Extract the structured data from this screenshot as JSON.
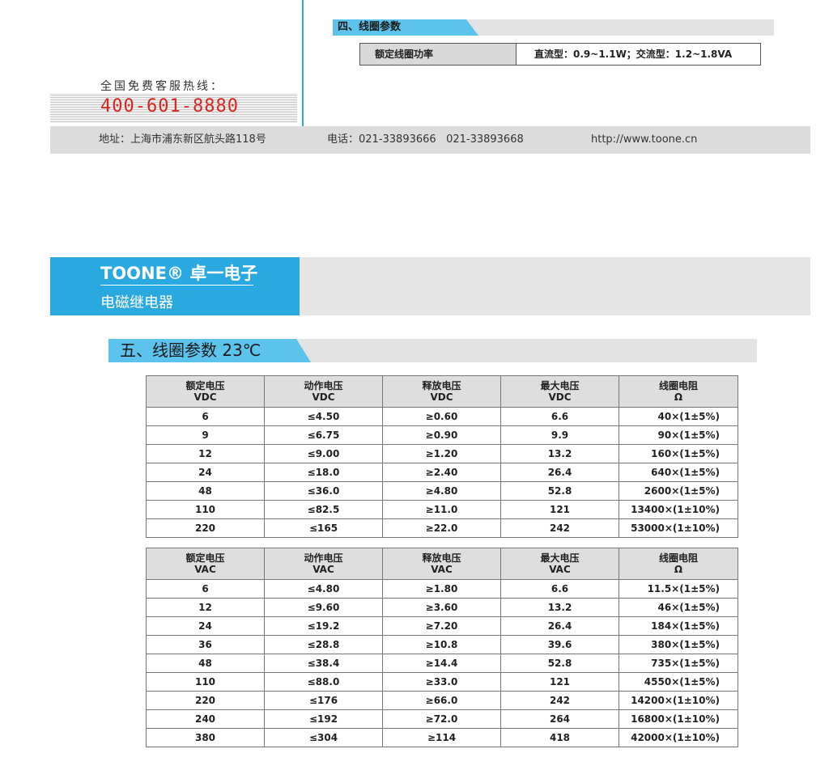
{
  "section4": {
    "title": "四、线圈参数",
    "coil_power_label": "额定线圈功率",
    "coil_power_value": "直流型：0.9~1.1W；交流型：1.2~1.8VA"
  },
  "hotline": {
    "label": "全国免费客服热线：",
    "number": "400-601-8880"
  },
  "contact": {
    "address": "地址：上海市浦东新区航头路118号",
    "phone": "电话：021-33893666   021-33893668",
    "website": "http://www.toone.cn"
  },
  "brand": {
    "name": "TOONE® 卓一电子",
    "subtitle": "电磁继电器"
  },
  "section5": {
    "title": "五、线圈参数 23℃"
  },
  "dc_table": {
    "headers": [
      {
        "line1": "额定电压",
        "line2": "VDC"
      },
      {
        "line1": "动作电压",
        "line2": "VDC"
      },
      {
        "line1": "释放电压",
        "line2": "VDC"
      },
      {
        "line1": "最大电压",
        "line2": "VDC"
      },
      {
        "line1": "线圈电阻",
        "line2": "Ω"
      }
    ],
    "rows": [
      [
        "6",
        "≤4.50",
        "≥0.60",
        "6.6",
        "40×(1±5%)"
      ],
      [
        "9",
        "≤6.75",
        "≥0.90",
        "9.9",
        "90×(1±5%)"
      ],
      [
        "12",
        "≤9.00",
        "≥1.20",
        "13.2",
        "160×(1±5%)"
      ],
      [
        "24",
        "≤18.0",
        "≥2.40",
        "26.4",
        "640×(1±5%)"
      ],
      [
        "48",
        "≤36.0",
        "≥4.80",
        "52.8",
        "2600×(1±5%)"
      ],
      [
        "110",
        "≤82.5",
        "≥11.0",
        "121",
        "13400×(1±10%)"
      ],
      [
        "220",
        "≤165",
        "≥22.0",
        "242",
        "53000×(1±10%)"
      ]
    ]
  },
  "ac_table": {
    "headers": [
      {
        "line1": "额定电压",
        "line2": "VAC"
      },
      {
        "line1": "动作电压",
        "line2": "VAC"
      },
      {
        "line1": "释放电压",
        "line2": "VAC"
      },
      {
        "line1": "最大电压",
        "line2": "VAC"
      },
      {
        "line1": "线圈电阻",
        "line2": "Ω"
      }
    ],
    "rows": [
      [
        "6",
        "≤4.80",
        "≥1.80",
        "6.6",
        "11.5×(1±5%)"
      ],
      [
        "12",
        "≤9.60",
        "≥3.60",
        "13.2",
        "46×(1±5%)"
      ],
      [
        "24",
        "≤19.2",
        "≥7.20",
        "26.4",
        "184×(1±5%)"
      ],
      [
        "36",
        "≤28.8",
        "≥10.8",
        "39.6",
        "380×(1±5%)"
      ],
      [
        "48",
        "≤38.4",
        "≥14.4",
        "52.8",
        "735×(1±5%)"
      ],
      [
        "110",
        "≤88.0",
        "≥33.0",
        "121",
        "4550×(1±5%)"
      ],
      [
        "220",
        "≤176",
        "≥66.0",
        "242",
        "14200×(1±10%)"
      ],
      [
        "240",
        "≤192",
        "≥72.0",
        "264",
        "16800×(1±10%)"
      ],
      [
        "380",
        "≤304",
        "≥114",
        "418",
        "42000×(1±10%)"
      ]
    ]
  }
}
